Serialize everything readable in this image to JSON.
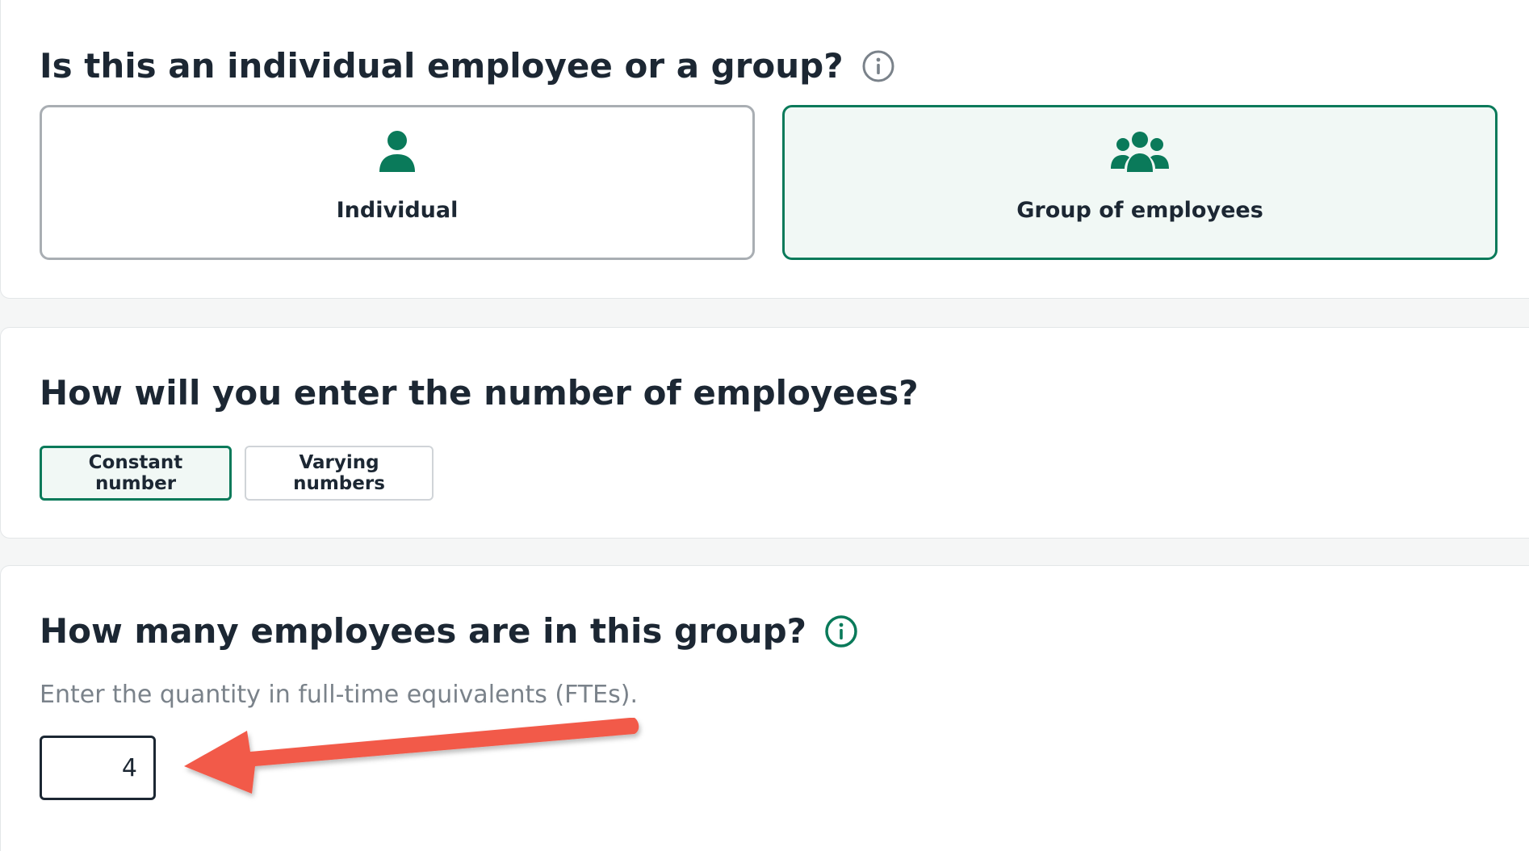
{
  "employee_type": {
    "question": "Is this an individual employee or a group?",
    "options": [
      {
        "label": "Individual",
        "icon": "person-icon",
        "selected": false
      },
      {
        "label": "Group of employees",
        "icon": "group-icon",
        "selected": true
      }
    ]
  },
  "entry_method": {
    "question": "How will you enter the number of employees?",
    "options": [
      {
        "label": "Constant number",
        "selected": true
      },
      {
        "label": "Varying numbers",
        "selected": false
      }
    ]
  },
  "group_size": {
    "question": "How many employees are in this group?",
    "hint": "Enter the quantity in full-time equivalents (FTEs).",
    "value": "4"
  },
  "colors": {
    "accent": "#0a7a5a",
    "selected_background": "#f1f8f5",
    "annotation_arrow": "#f25a4a",
    "text": "#1c2733",
    "muted_text": "#7a828a"
  }
}
